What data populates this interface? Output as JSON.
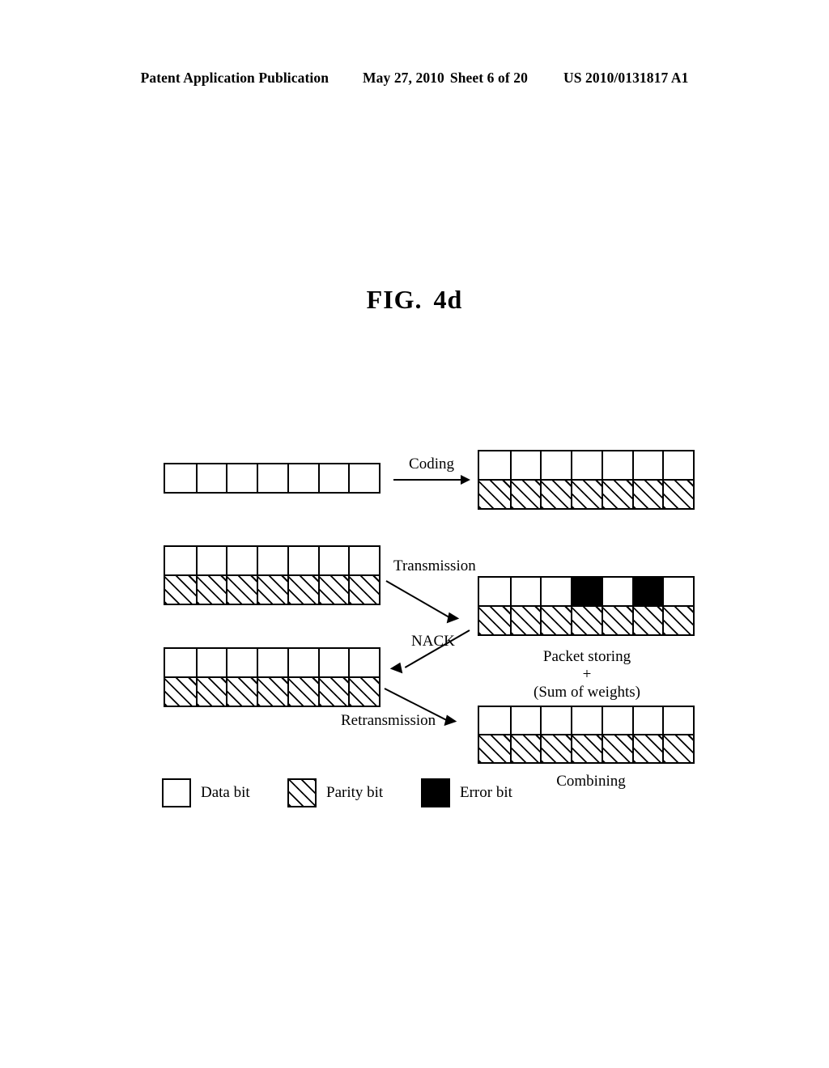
{
  "header": {
    "publication": "Patent Application Publication",
    "date": "May 27, 2010",
    "sheet": "Sheet 6 of 20",
    "patent_number": "US 2010/0131817 A1"
  },
  "figure": {
    "label": "FIG.",
    "number": "4d"
  },
  "diagram": {
    "labels": {
      "coding": "Coding",
      "transmission": "Transmission",
      "nack": "NACK",
      "retransmission": "Retransmission",
      "packet_storing_line1": "Packet storing",
      "packet_storing_line2": "+",
      "packet_storing_line3": "(Sum of weights)",
      "combining": "Combining"
    },
    "packets": [
      {
        "id": "source-data-packet",
        "rows": [
          [
            "data",
            "data",
            "data",
            "data",
            "data",
            "data",
            "data"
          ]
        ]
      },
      {
        "id": "coded-packet",
        "rows": [
          [
            "data",
            "data",
            "data",
            "data",
            "data",
            "data",
            "data"
          ],
          [
            "parity",
            "parity",
            "parity",
            "parity",
            "parity",
            "parity",
            "parity"
          ]
        ]
      },
      {
        "id": "transmitted-packet",
        "rows": [
          [
            "data",
            "data",
            "data",
            "data",
            "data",
            "data",
            "data"
          ],
          [
            "parity",
            "parity",
            "parity",
            "parity",
            "parity",
            "parity",
            "parity"
          ]
        ]
      },
      {
        "id": "received-packet-with-errors",
        "rows": [
          [
            "data",
            "data",
            "data",
            "error",
            "data",
            "error",
            "data"
          ],
          [
            "parity",
            "parity",
            "parity",
            "parity",
            "parity",
            "parity",
            "parity"
          ]
        ]
      },
      {
        "id": "retransmitted-packet",
        "rows": [
          [
            "data",
            "data",
            "data",
            "data",
            "data",
            "data",
            "data"
          ],
          [
            "parity",
            "parity",
            "parity",
            "parity",
            "parity",
            "parity",
            "parity"
          ]
        ]
      },
      {
        "id": "combined-packet",
        "rows": [
          [
            "data",
            "data",
            "data",
            "data",
            "data",
            "data",
            "data"
          ],
          [
            "parity",
            "parity",
            "parity",
            "parity",
            "parity",
            "parity",
            "parity"
          ]
        ]
      }
    ]
  },
  "legend": {
    "items": [
      {
        "type": "data",
        "label": "Data bit"
      },
      {
        "type": "parity",
        "label": "Parity bit"
      },
      {
        "type": "error",
        "label": "Error bit"
      }
    ]
  },
  "colors": {
    "ink": "#000000",
    "paper": "#ffffff",
    "error_fill": "#000000"
  }
}
